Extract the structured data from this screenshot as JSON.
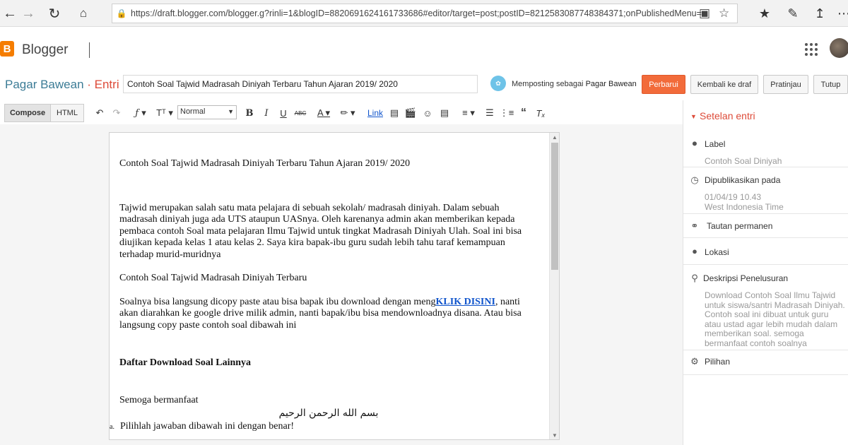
{
  "browser": {
    "url": "https://draft.blogger.com/blogger.g?rinli=1&blogID=8820691624161733686#editor/target=post;postID=8212583087748384371;onPublishedMenu=all"
  },
  "header": {
    "logo_letter": "B",
    "app_name": "Blogger"
  },
  "post": {
    "blog_name": "Pagar Bawean",
    "separator": " · ",
    "mode": "Entri",
    "title": "Contoh Soal Tajwid Madrasah Diniyah Terbaru Tahun Ajaran 2019/ 2020",
    "posting_as_prefix": "Memposting sebagai",
    "posting_as_name": "Pagar Bawean",
    "buttons": {
      "update": "Perbarui",
      "revert": "Kembali ke draf",
      "preview": "Pratinjau",
      "close": "Tutup"
    }
  },
  "toolbar": {
    "compose": "Compose",
    "html": "HTML",
    "font_size": "Normal",
    "link": "Link"
  },
  "editor": {
    "heading": "Contoh Soal Tajwid Madrasah Diniyah Terbaru Tahun Ajaran 2019/ 2020",
    "para1": "Tajwid merupakan salah satu mata pelajara di sebuah sekolah/ madrasah diniyah. Dalam sebuah madrasah diniyah juga ada UTS ataupun UASnya. Oleh karenanya admin akan memberikan kepada pembaca contoh Soal mata pelajaran Ilmu Tajwid untuk tingkat Madrasah Diniyah Ulah. Soal ini bisa diujikan kepada kelas 1 atau kelas 2. Saya kira bapak-ibu guru sudah lebih tahu taraf kemampuan terhadap murid-muridnya",
    "subheading": "Contoh Soal Tajwid Madrasah Diniyah Terbaru",
    "para2_before": "Soalnya bisa langsung dicopy paste atau bisa bapak ibu download dengan meng",
    "para2_link": "KLIK DISINI",
    "para2_after": ", nanti akan diarahkan ke google drive milik admin, nanti bapak/ibu bisa mendownloadnya disana. Atau bisa langsung copy paste contoh soal dibawah ini",
    "list_title": "Daftar Download Soal Lainnya",
    "closing": "Semoga bermanfaat",
    "basmalah": "بسم الله الرحمن الرحيم",
    "question_marker": "a.",
    "question": "Pilihlah jawaban dibawah ini dengan benar!"
  },
  "settings": {
    "title": "Setelan entri",
    "label_title": "Label",
    "label_value": "Contoh Soal Diniyah",
    "published_title": "Dipublikasikan pada",
    "published_date": "01/04/19 10.43",
    "published_tz": "West Indonesia Time",
    "permalink": "Tautan permanen",
    "location": "Lokasi",
    "search_desc_title": "Deskripsi Penelusuran",
    "search_desc_value": "Download Contoh Soal Ilmu Tajwid untuk siswa/santri Madrasah Diniyah. Contoh soal ini dibuat untuk guru atau ustad agar lebih mudah dalam memberikan soal. semoga bermanfaat contoh soalnya",
    "options": "Pilihan"
  }
}
